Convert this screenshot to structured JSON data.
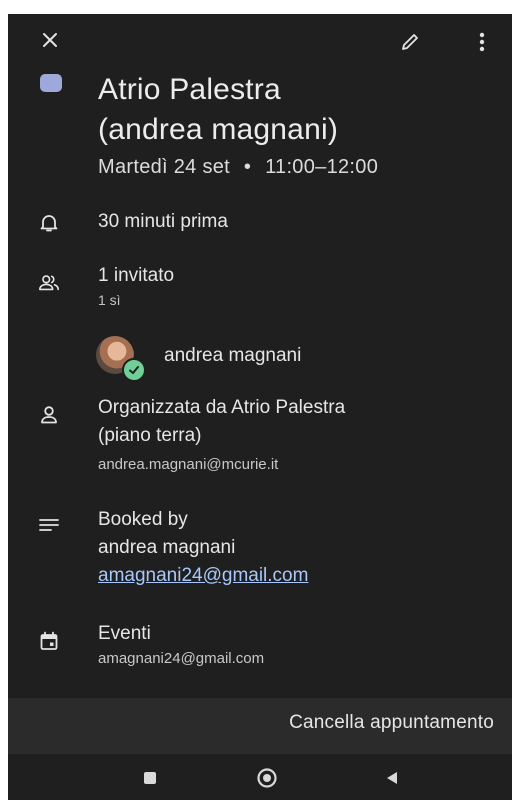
{
  "toolbar": {
    "close_icon": "close-icon",
    "edit_icon": "edit-pencil-icon",
    "more_icon": "more-vert-icon"
  },
  "event": {
    "color": "#9fa8da",
    "title_line1": "Atrio Palestra",
    "title_line2": "(andrea magnani)",
    "date": "Martedì 24 set",
    "separator": "•",
    "time": "11:00–12:00"
  },
  "notification": {
    "icon": "bell-icon",
    "text": "30 minuti prima"
  },
  "guests": {
    "icon": "people-icon",
    "count_label": "1 invitato",
    "responses": "1 sì",
    "list": [
      {
        "name": "andrea magnani",
        "status_icon": "check-icon"
      }
    ]
  },
  "organizer": {
    "icon": "person-icon",
    "line1": "Organizzata da Atrio Palestra",
    "line2": "(piano terra)",
    "email": "andrea.magnani@mcurie.it"
  },
  "description": {
    "icon": "notes-icon",
    "line1": "Booked by",
    "line2": "andrea magnani",
    "link": "amagnani24@gmail.com"
  },
  "calendar": {
    "icon": "calendar-icon",
    "name": "Eventi",
    "account": "amagnani24@gmail.com"
  },
  "actions": {
    "cancel_label": "Cancella appuntamento"
  },
  "navigation": {
    "recents_icon": "square-icon",
    "home_icon": "circle-icon",
    "back_icon": "triangle-back-icon"
  }
}
